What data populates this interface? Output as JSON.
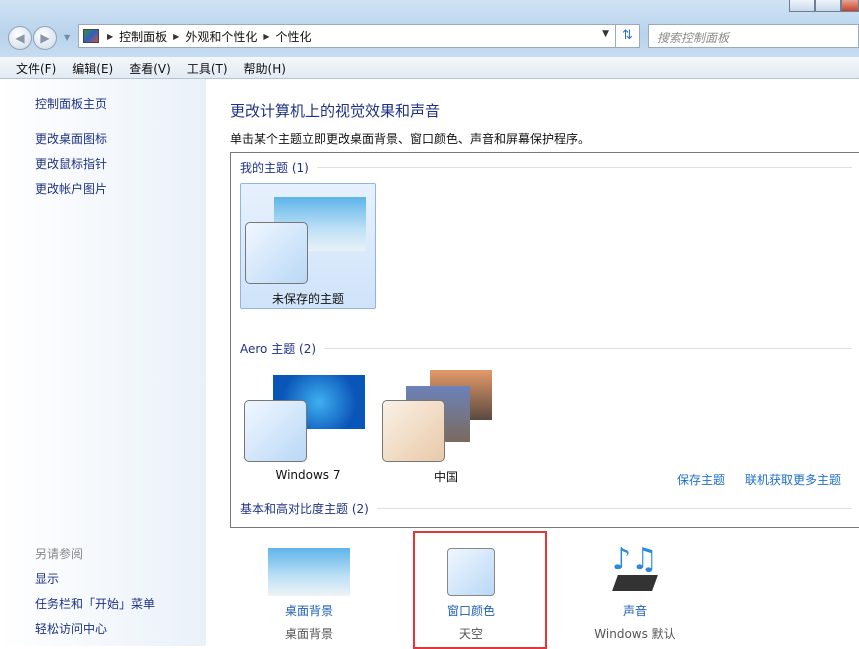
{
  "address": {
    "crumbs": [
      "控制面板",
      "外观和个性化",
      "个性化"
    ]
  },
  "search": {
    "placeholder": "搜索控制面板"
  },
  "menu": [
    "文件(F)",
    "编辑(E)",
    "查看(V)",
    "工具(T)",
    "帮助(H)"
  ],
  "sidebar": {
    "home": "控制面板主页",
    "links": [
      "更改桌面图标",
      "更改鼠标指针",
      "更改帐户图片"
    ],
    "see_also": "另请参阅",
    "see_links": [
      "显示",
      "任务栏和「开始」菜单",
      "轻松访问中心"
    ]
  },
  "main": {
    "title": "更改计算机上的视觉效果和声音",
    "desc": "单击某个主题立即更改桌面背景、窗口颜色、声音和屏幕保护程序。",
    "groups": [
      "我的主题 (1)",
      "Aero 主题 (2)",
      "基本和高对比度主题 (2)"
    ],
    "my_themes": [
      {
        "label": "未保存的主题",
        "selected": true
      }
    ],
    "aero_themes": [
      {
        "label": "Windows 7"
      },
      {
        "label": "中国"
      }
    ],
    "save_theme": "保存主题",
    "get_more": "联机获取更多主题"
  },
  "bottom": [
    {
      "title": "桌面背景",
      "value": "桌面背景"
    },
    {
      "title": "窗口颜色",
      "value": "天空",
      "highlighted": true
    },
    {
      "title": "声音",
      "value": "Windows 默认"
    }
  ],
  "colors": {
    "link": "#1e3287",
    "highlight": "#e63535"
  }
}
